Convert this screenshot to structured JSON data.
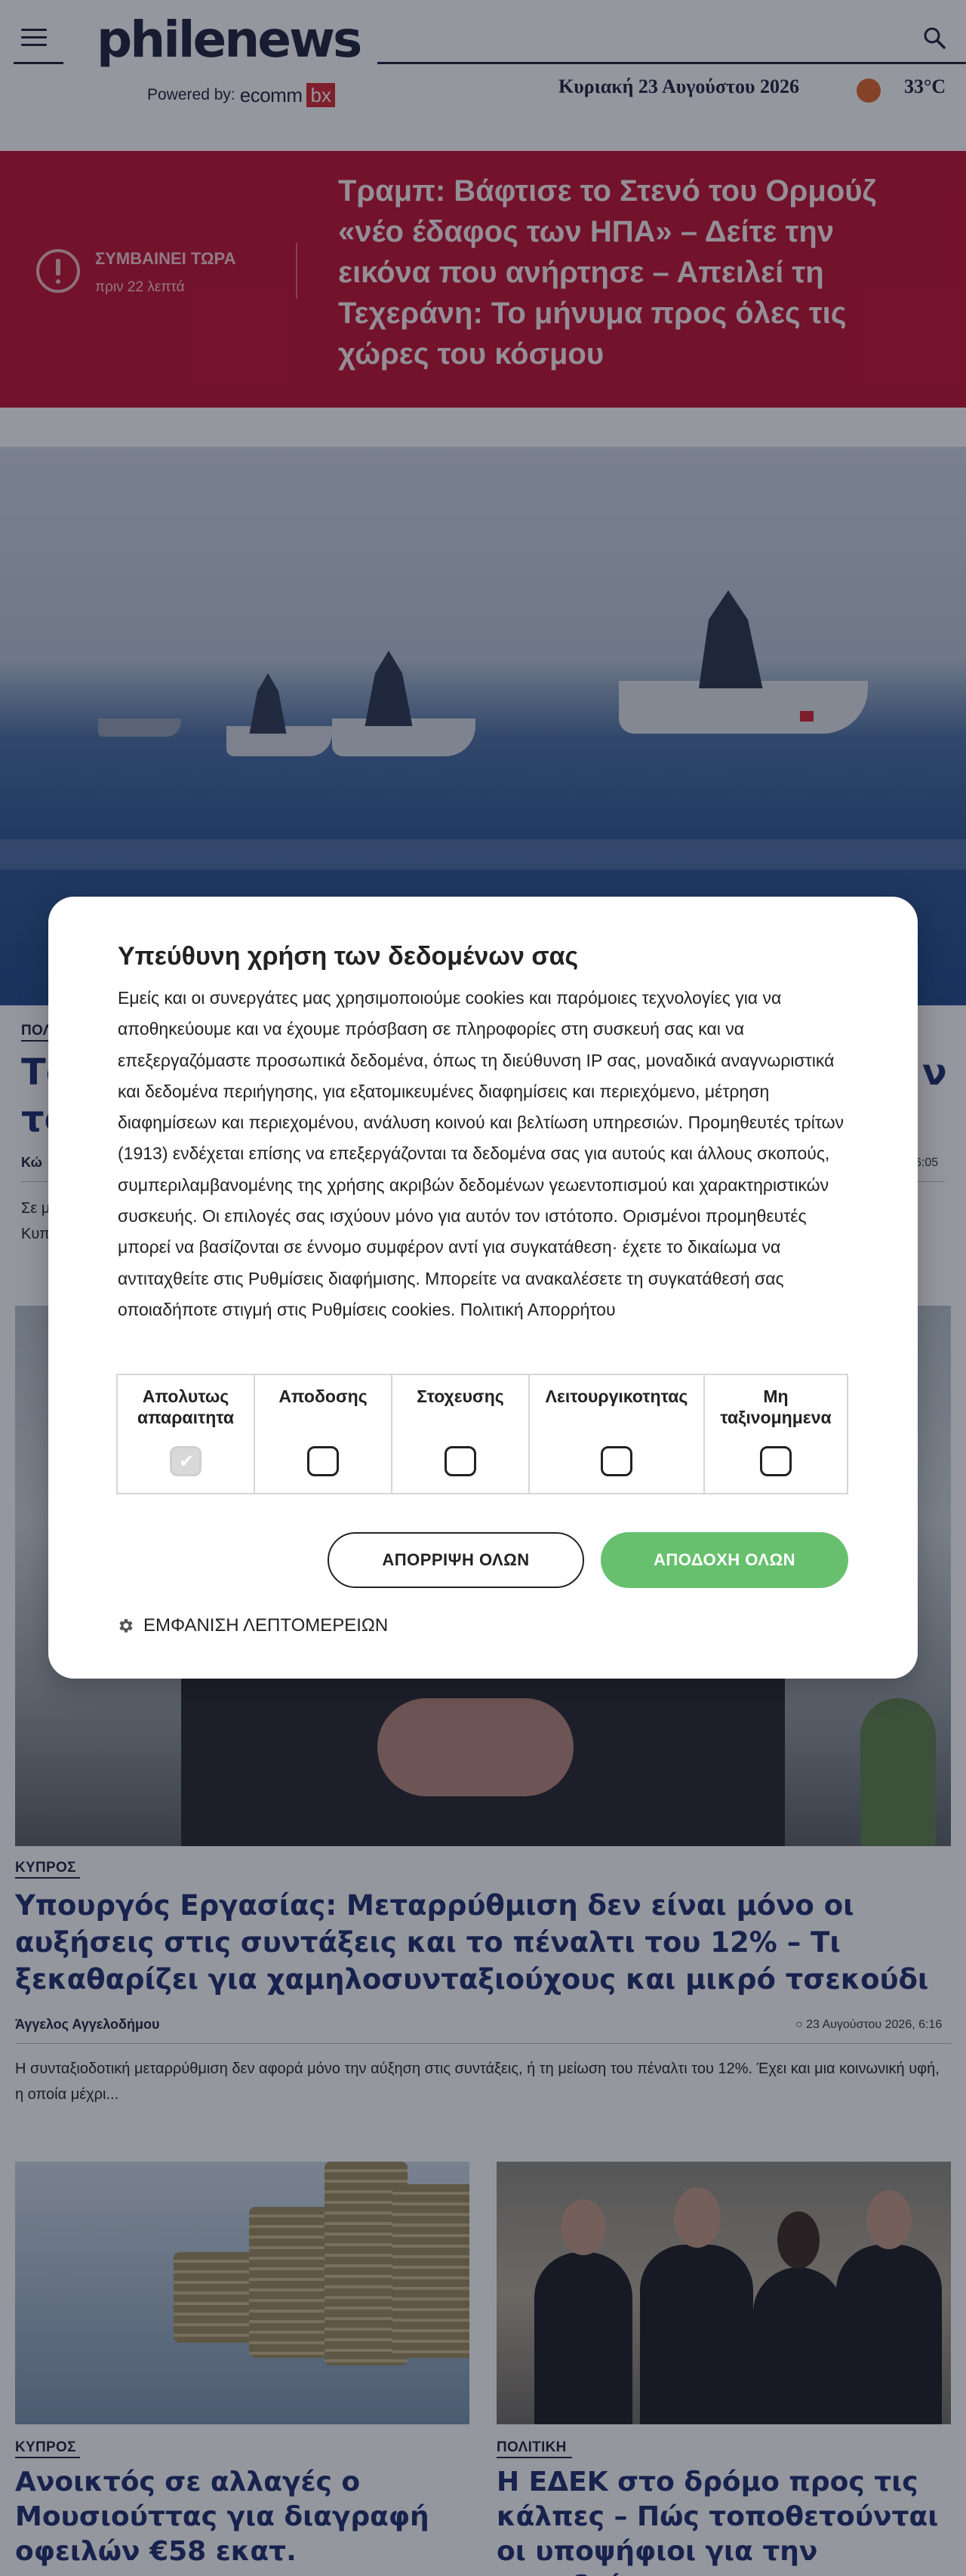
{
  "header": {
    "logo": "philenews",
    "powered_prefix": "Powered by:",
    "powered_brand": "ecomm",
    "powered_brand_box": "bx",
    "date": "Κυριακή 23 Αυγούστου 2026",
    "temperature": "33°C"
  },
  "breaking": {
    "label": "ΣΥΜΒΑΙΝΕΙ ΤΩΡΑ",
    "time": "πριν 22 λεπτά",
    "title": "Τραμπ: Βάφτισε το Στενό του Ορμούζ «νέο έδαφος των ΗΠΑ» – Δείτε την εικόνα που ανήρτησε – Απειλεί τη Τεχεράνη: Το μήνυμα προς όλες τις χώρες του κόσμου"
  },
  "main_article": {
    "category": "ΠΟΛ",
    "title_left": "Το",
    "title_left2": "το",
    "title_right": "ν",
    "author": "Κώ",
    "time": "6:05",
    "excerpt_1": "Σε μ",
    "excerpt_2": "Κυπ"
  },
  "second_article": {
    "category": "ΚΥΠΡΟΣ",
    "title": "Υπουργός Εργασίας: Μεταρρύθμιση δεν είναι μόνο οι αυξήσεις στις συντάξεις και το πέναλτι του 12% – Τι ξεκαθαρίζει για χαμηλοσυνταξιούχους και μικρό τσεκούδι",
    "author": "Άγγελος Αγγελοδήμου",
    "datetime": "23 Αυγούστου 2026, 6:16",
    "excerpt": "Η συνταξιοδοτική μεταρρύθμιση δεν αφορά μόνο την αύξηση στις συντάξεις, ή τη μείωση του πέναλτι του 12%. Έχει και μια κοινωνική υφή, η οποία μέχρι..."
  },
  "cards": [
    {
      "category": "ΚΥΠΡΟΣ",
      "title": "Ανοικτός σε αλλαγές ο Μουσιούττας για διαγραφή οφειλών €58 εκατ."
    },
    {
      "category": "ΠΟΛΙΤΙΚΗ",
      "title": "Η ΕΔΕΚ στο δρόμο προς τις κάλπες – Πώς τοποθετούνται οι υποψήφιοι για την προεδρία"
    }
  ],
  "consent": {
    "title": "Υπεύθυνη χρήση των δεδομένων σας",
    "text": "Εμείς και οι συνεργάτες μας χρησιμοποιούμε cookies και παρόμοιες τεχνολογίες για να αποθηκεύουμε και να έχουμε πρόσβαση σε πληροφορίες στη συσκευή σας και να επεξεργαζόμαστε προσωπικά δεδομένα, όπως τη διεύθυνση IP σας, μοναδικά αναγνωριστικά και δεδομένα περιήγησης, για εξατομικευμένες διαφημίσεις και περιεχόμενο, μέτρηση διαφημίσεων και περιεχομένου, ανάλυση κοινού και βελτίωση υπηρεσιών. Προμηθευτές τρίτων (1913) ενδέχεται επίσης να επεξεργάζονται τα δεδομένα σας για αυτούς και άλλους σκοπούς, συμπεριλαμβανομένης της χρήσης ακριβών δεδομένων γεωεντοπισμού και χαρακτηριστικών συσκευής. Οι επιλογές σας ισχύουν μόνο για αυτόν τον ιστότοπο. Ορισμένοι προμηθευτές μπορεί να βασίζονται σε έννομο συμφέρον αντί για συγκατάθεση· έχετε το δικαίωμα να αντιταχθείτε στις Ρυθμίσεις διαφήμισης. Μπορείτε να ανακαλέσετε τη συγκατάθεσή σας οποιαδήποτε στιγμή στις Ρυθμίσεις cookies. Πολιτική Απορρήτου",
    "categories": [
      {
        "label": "Απολυτως απαραιτητα",
        "checked": true,
        "disabled": true
      },
      {
        "label": "Αποδοσης",
        "checked": false,
        "disabled": false
      },
      {
        "label": "Στοχευσης",
        "checked": false,
        "disabled": false
      },
      {
        "label": "Λειτουργικοτητας",
        "checked": false,
        "disabled": false
      },
      {
        "label": "Μη ταξινομημενα",
        "checked": false,
        "disabled": false
      }
    ],
    "reject_label": "ΑΠΟΡΡΙΨΗ ΟΛΩΝ",
    "accept_label": "ΑΠΟΔΟΧΗ ΟΛΩΝ",
    "details_label": "ΕΜΦΑΝΙΣΗ ΛΕΠΤΟΜΕΡΕΙΩΝ"
  },
  "colors": {
    "brand_navy": "#1a1f3a",
    "breaking_red": "#c20e2e",
    "accept_green": "#67c06d"
  }
}
